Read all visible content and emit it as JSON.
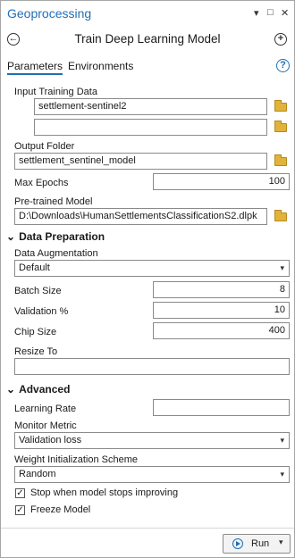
{
  "window": {
    "title": "Geoprocessing",
    "controls": [
      "▾",
      "□",
      "✕"
    ]
  },
  "tool": {
    "title": "Train Deep Learning Model",
    "back_glyph": "←",
    "add_glyph": "+"
  },
  "tabs": [
    {
      "label": "Parameters"
    },
    {
      "label": "Environments"
    }
  ],
  "help_glyph": "?",
  "params": {
    "input_training_data": {
      "label": "Input Training Data",
      "values": [
        "settlement-sentinel2",
        ""
      ]
    },
    "output_folder": {
      "label": "Output Folder",
      "value": "settlement_sentinel_model"
    },
    "max_epochs": {
      "label": "Max Epochs",
      "value": "100"
    },
    "pretrained_model": {
      "label": "Pre-trained Model",
      "value": "D:\\Downloads\\HumanSettlementsClassificationS2.dlpk"
    }
  },
  "data_prep": {
    "section": "Data Preparation",
    "augmentation": {
      "label": "Data Augmentation",
      "value": "Default"
    },
    "batch_size": {
      "label": "Batch Size",
      "value": "8"
    },
    "validation": {
      "label": "Validation %",
      "value": "10"
    },
    "chip_size": {
      "label": "Chip Size",
      "value": "400"
    },
    "resize_to": {
      "label": "Resize To",
      "value": ""
    }
  },
  "advanced": {
    "section": "Advanced",
    "learning_rate": {
      "label": "Learning Rate",
      "value": ""
    },
    "monitor_metric": {
      "label": "Monitor Metric",
      "value": "Validation loss"
    },
    "weight_init": {
      "label": "Weight Initialization Scheme",
      "value": "Random"
    },
    "stop_improving": {
      "label": "Stop when model stops improving",
      "checked": true
    },
    "freeze_model": {
      "label": "Freeze Model",
      "checked": true
    }
  },
  "run": {
    "label": "Run"
  },
  "colors": {
    "accent": "#1f6fb5",
    "folder": "#e2b33b"
  }
}
